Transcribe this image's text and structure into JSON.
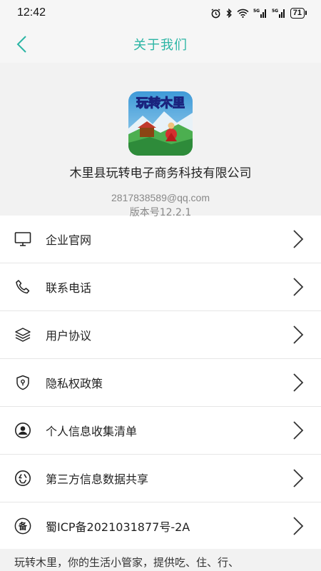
{
  "status_bar": {
    "time": "12:42",
    "battery": "71",
    "icons": [
      "alarm-icon",
      "bluetooth-icon",
      "wifi-icon",
      "signal-5g-icon",
      "signal-5g-icon"
    ]
  },
  "header": {
    "title": "关于我们",
    "accent_color": "#2bb5a4"
  },
  "profile": {
    "logo_text": "玩转木里",
    "company": "木里县玩转电子商务科技有限公司",
    "email": "2817838589@qq.com",
    "version": "版本号12.2.1"
  },
  "menu": [
    {
      "label": "企业官网",
      "icon": "monitor-icon"
    },
    {
      "label": "联系电话",
      "icon": "phone-icon"
    },
    {
      "label": "用户协议",
      "icon": "layers-icon"
    },
    {
      "label": "隐私权政策",
      "icon": "shield-icon"
    },
    {
      "label": "个人信息收集清单",
      "icon": "user-circle-icon"
    },
    {
      "label": "第三方信息数据共享",
      "icon": "recycle-icon"
    },
    {
      "label": "蜀ICP备2021031877号-2A",
      "icon": "beian-icon"
    }
  ],
  "footer": {
    "text": "玩转木里，你的生活小管家，提供吃、住、行、"
  }
}
